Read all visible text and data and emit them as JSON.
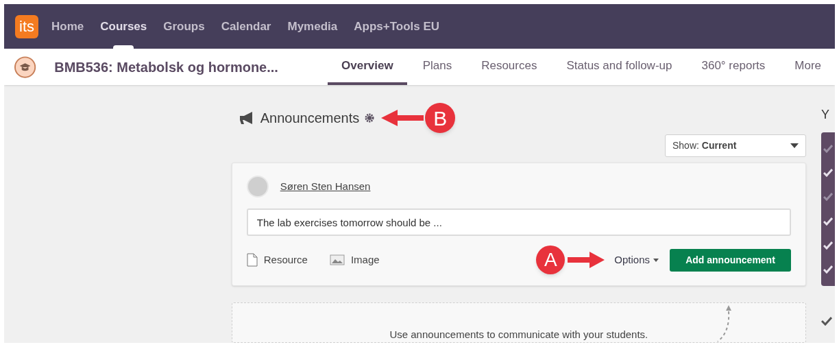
{
  "top_nav": {
    "logo": "its",
    "items": [
      {
        "label": "Home",
        "selected": false
      },
      {
        "label": "Courses",
        "selected": true
      },
      {
        "label": "Groups",
        "selected": false
      },
      {
        "label": "Calendar",
        "selected": false
      },
      {
        "label": "Mymedia",
        "selected": false
      },
      {
        "label": "Apps+Tools EU",
        "selected": false
      }
    ]
  },
  "course_bar": {
    "title": "BMB536: Metabolsk og hormone...",
    "tabs": [
      {
        "label": "Overview",
        "selected": true
      },
      {
        "label": "Plans",
        "selected": false
      },
      {
        "label": "Resources",
        "selected": false
      },
      {
        "label": "Status and follow-up",
        "selected": false
      },
      {
        "label": "360° reports",
        "selected": false
      },
      {
        "label": "More",
        "selected": false
      }
    ]
  },
  "announcements": {
    "title": "Announcements",
    "filter": {
      "label": "Show:",
      "value": "Current"
    },
    "composer": {
      "author": "Søren Sten Hansen",
      "value": "The lab exercises tomorrow should be ...",
      "attachments": [
        {
          "kind": "resource",
          "label": "Resource"
        },
        {
          "kind": "image",
          "label": "Image"
        }
      ],
      "options": "Options",
      "submit": "Add announcement"
    },
    "empty_hint": "Use announcements to communicate with your students."
  },
  "settings_callout": {
    "label": "B"
  },
  "options_callout": {
    "label": "A"
  },
  "side_panel": {
    "heading": "Y"
  }
}
